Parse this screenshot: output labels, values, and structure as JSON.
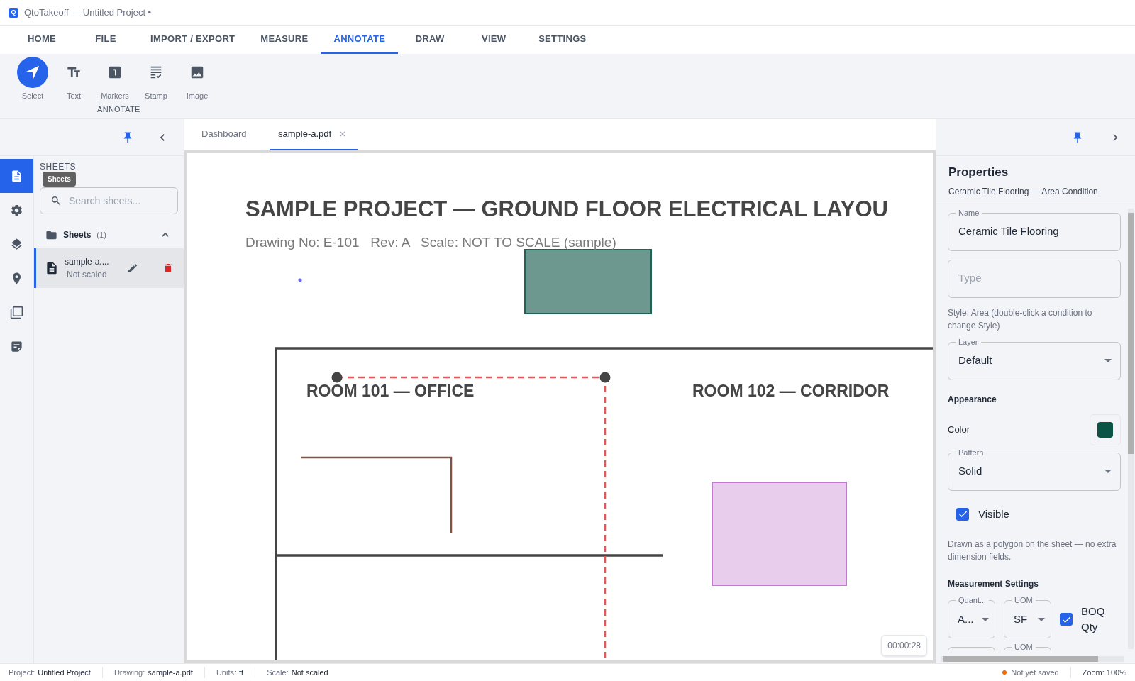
{
  "window": {
    "logo_letter": "Q",
    "title": "QtoTakeoff — Untitled Project •"
  },
  "menu_tabs": [
    {
      "label": "HOME",
      "selected": false
    },
    {
      "label": "FILE",
      "selected": false
    },
    {
      "label": "IMPORT / EXPORT",
      "selected": false
    },
    {
      "label": "MEASURE",
      "selected": false
    },
    {
      "label": "ANNOTATE",
      "selected": true
    },
    {
      "label": "DRAW",
      "selected": false
    },
    {
      "label": "VIEW",
      "selected": false
    },
    {
      "label": "SETTINGS",
      "selected": false
    }
  ],
  "ribbon": {
    "group_label": "ANNOTATE",
    "tools": [
      {
        "kind": "select",
        "label": "Select",
        "selected": true
      },
      {
        "kind": "text",
        "label": "Text",
        "selected": false
      },
      {
        "kind": "markers",
        "label": "Markers",
        "selected": false
      },
      {
        "kind": "stamp",
        "label": "Stamp",
        "selected": false
      },
      {
        "kind": "image",
        "label": "Image",
        "selected": false
      }
    ]
  },
  "left_rail": [
    {
      "kind": "sheets",
      "selected": true
    },
    {
      "kind": "settings",
      "selected": false
    },
    {
      "kind": "layers",
      "selected": false
    },
    {
      "kind": "location",
      "selected": false
    },
    {
      "kind": "copies",
      "selected": false
    },
    {
      "kind": "notes",
      "selected": false
    }
  ],
  "tooltip": "Sheets",
  "sheets_panel": {
    "heading": "SHEETS",
    "search_placeholder": "Search sheets...",
    "group": {
      "label": "Sheets",
      "count": "(1)",
      "expanded": true
    },
    "items": [
      {
        "name": "sample-a....",
        "status": "Not scaled",
        "selected": true
      }
    ]
  },
  "doc_tabs": [
    {
      "label": "Dashboard",
      "selected": false,
      "closable": false
    },
    {
      "label": "sample-a.pdf",
      "selected": true,
      "closable": true
    }
  ],
  "sheet": {
    "title": "SAMPLE PROJECT — GROUND FLOOR ELECTRICAL LAYOU",
    "subtitle": "Drawing No: E-101   Rev: A   Scale: NOT TO SCALE (sample)",
    "rooms": [
      "ROOM 101 — OFFICE",
      "ROOM 102 — CORRIDOR"
    ],
    "timer": "00:00:28"
  },
  "properties": {
    "title": "Properties",
    "subtitle": "Ceramic Tile Flooring — Area Condition",
    "name": {
      "label": "Name",
      "value": "Ceramic Tile Flooring"
    },
    "type": {
      "placeholder": "Type"
    },
    "style_hint": "Style: Area (double-click a condition to change Style)",
    "layer": {
      "label": "Layer",
      "value": "Default"
    },
    "appearance_heading": "Appearance",
    "color": {
      "label": "Color",
      "color": "#0b5345"
    },
    "pattern": {
      "label": "Pattern",
      "value": "Solid"
    },
    "visible": {
      "label": "Visible",
      "checked": true
    },
    "note": "Drawn as a polygon on the sheet — no extra dimension fields.",
    "measurement_heading": "Measurement Settings",
    "quantity": {
      "label": "Quant...",
      "value": "A..."
    },
    "uom": {
      "label": "UOM",
      "value": "SF"
    },
    "boq": {
      "label": "BOQ Qty",
      "checked": true
    },
    "next_row_label": "UOM"
  },
  "status_bar": {
    "items": [
      {
        "label": "Project:",
        "value": "Untitled Project"
      },
      {
        "label": "Drawing:",
        "value": "sample-a.pdf"
      },
      {
        "label": "Units:",
        "value": "ft"
      },
      {
        "label": "Scale:",
        "value": "Not scaled"
      }
    ],
    "save_state": "Not yet saved",
    "zoom": "Zoom: 100%"
  }
}
